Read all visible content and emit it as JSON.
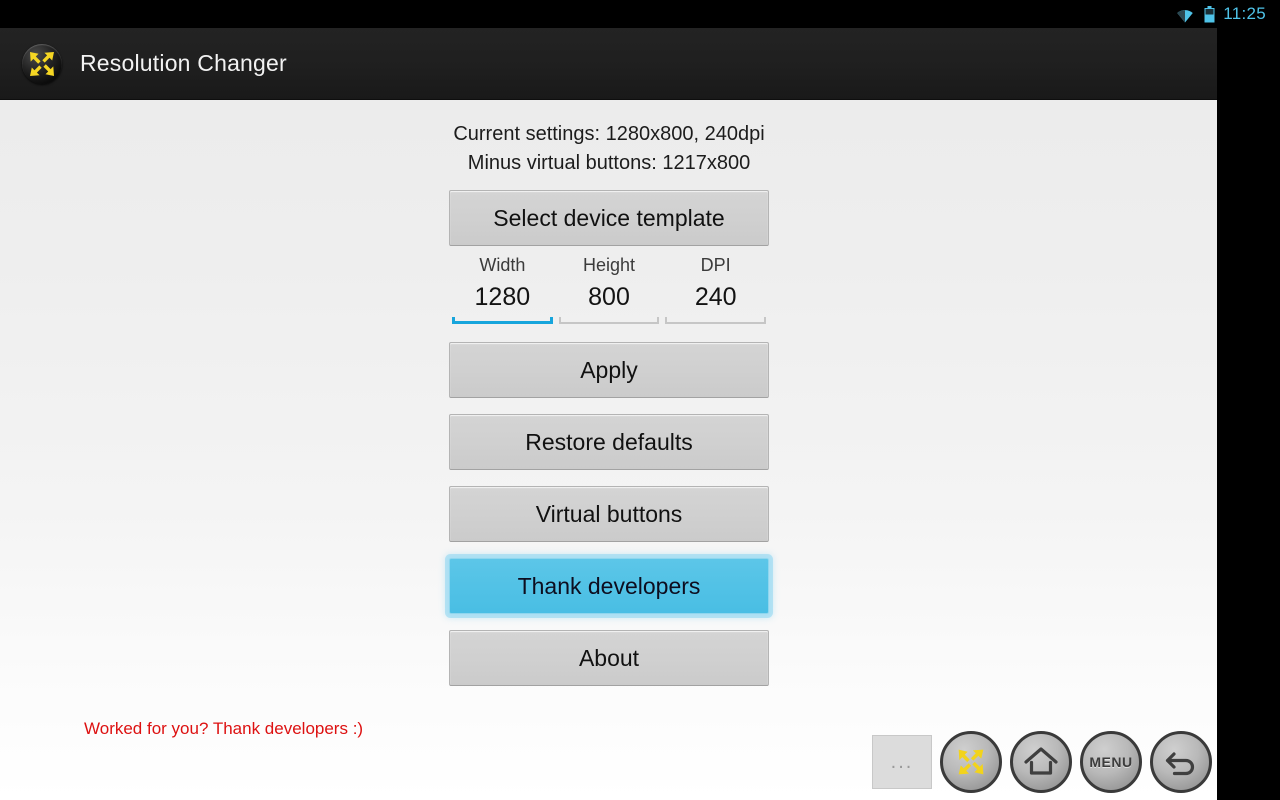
{
  "status_bar": {
    "wifi_icon": "wifi-icon",
    "battery_icon": "battery-icon",
    "clock": "11:25",
    "accent_color": "#4fc3e8"
  },
  "action_bar": {
    "app_icon": "resolution-changer-icon",
    "title": "Resolution Changer"
  },
  "main": {
    "current_settings": "Current settings: 1280x800, 240dpi",
    "minus_virtual_buttons": "Minus virtual buttons: 1217x800",
    "select_template_label": "Select device template",
    "fields": [
      {
        "name": "width",
        "label": "Width",
        "value": "1280",
        "focused": true
      },
      {
        "name": "height",
        "label": "Height",
        "value": "800",
        "focused": false
      },
      {
        "name": "dpi",
        "label": "DPI",
        "value": "240",
        "focused": false
      }
    ],
    "apply_label": "Apply",
    "restore_defaults_label": "Restore defaults",
    "virtual_buttons_label": "Virtual buttons",
    "thank_developers_label": "Thank developers",
    "thank_hint": "Worked for you? Thank developers :)",
    "thank_hint_color": "#dd1111",
    "thank_button_color": "#52c2e6",
    "about_label": "About"
  },
  "nav_overlay": {
    "handle_label": "...",
    "buttons": [
      {
        "name": "app-shortcut",
        "icon": "resolution-changer-icon",
        "label": ""
      },
      {
        "name": "home",
        "icon": "home-icon",
        "label": ""
      },
      {
        "name": "menu",
        "icon": "menu-icon",
        "label": "MENU"
      },
      {
        "name": "back",
        "icon": "back-icon",
        "label": ""
      }
    ]
  }
}
